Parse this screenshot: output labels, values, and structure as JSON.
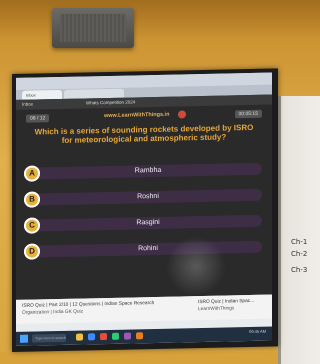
{
  "browser": {
    "tab_label": "Inbox"
  },
  "video": {
    "topbar_left": "Inbox",
    "topbar_mid": "Whats Competition 2024",
    "topbar_right": ""
  },
  "quiz": {
    "progress": "08 / 12",
    "site": "www.LearnWithThings.in",
    "timer": "00:05:15",
    "question": "Which is a series of sounding rockets developed by ISRO for meteorological and atmospheric study?",
    "options": [
      {
        "letter": "A",
        "text": "Rambha"
      },
      {
        "letter": "B",
        "text": "Roshni"
      },
      {
        "letter": "C",
        "text": "Rasgini"
      },
      {
        "letter": "D",
        "text": "Rohini"
      }
    ]
  },
  "footer": {
    "title": "ISRO Quiz | Part 2/10 | 12 Questions | Indian Space Research",
    "subtitle": "Organization | India GK Quiz",
    "right_title": "ISRO Quiz | Indian Spac...",
    "right_subtitle": "LearnWithThings"
  },
  "taskbar": {
    "search_placeholder": "Type here to search",
    "clock": "09:45 AM"
  },
  "whiteboard": {
    "notes": [
      "Ch-1",
      "Ch-2",
      "Ch-3"
    ]
  }
}
